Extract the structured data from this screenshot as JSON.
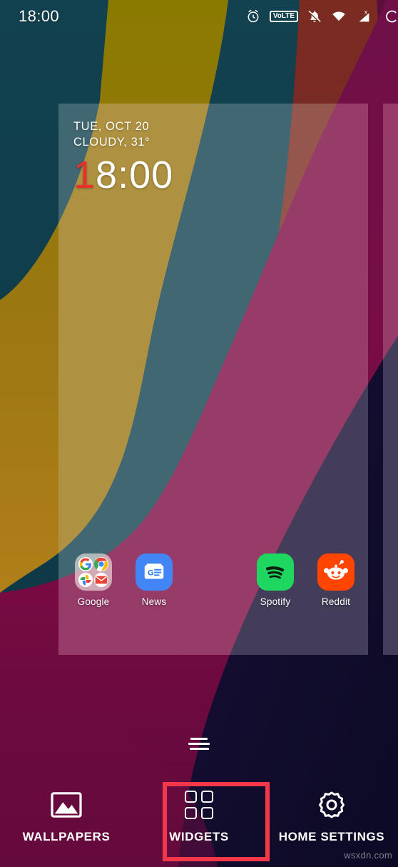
{
  "status_bar": {
    "clock": "18:00",
    "icons": [
      {
        "name": "alarm-icon",
        "label": "alarm"
      },
      {
        "name": "volte-icon",
        "label": "VoLTE"
      },
      {
        "name": "notifications-muted-icon",
        "label": "notifications muted"
      },
      {
        "name": "wifi-icon",
        "label": "wifi"
      },
      {
        "name": "cellular-signal-icon",
        "label": "no sim"
      },
      {
        "name": "battery-icon",
        "label": "battery"
      }
    ],
    "volte_text": "VoLTE"
  },
  "clock_widget": {
    "date": "TUE, OCT 20",
    "weather": "CLOUDY, 31°",
    "time_highlight": "1",
    "time_rest": "8:00",
    "highlight_color": "#e8302c"
  },
  "apps": [
    {
      "name": "google-folder",
      "label": "Google",
      "type": "folder",
      "items": [
        "google-g-icon",
        "chrome-icon",
        "photos-icon",
        "gmail-icon"
      ]
    },
    {
      "name": "news-app",
      "label": "News",
      "type": "app",
      "icon": "google-news-icon"
    },
    {
      "name": "spotify-app",
      "label": "Spotify",
      "type": "app",
      "icon": "spotify-icon"
    },
    {
      "name": "reddit-app",
      "label": "Reddit",
      "type": "app",
      "icon": "reddit-icon"
    }
  ],
  "toolbar": {
    "items": [
      {
        "name": "wallpapers-button",
        "label": "WALLPAPERS",
        "icon": "image-icon",
        "selected": false
      },
      {
        "name": "widgets-button",
        "label": "WIDGETS",
        "icon": "widgets-grid-icon",
        "selected": true
      },
      {
        "name": "home-settings-button",
        "label": "HOME SETTINGS",
        "icon": "gear-icon",
        "selected": false
      }
    ],
    "highlight_color": "#f4384a"
  },
  "page_indicator": {
    "name": "page-indicator",
    "lines": 3
  },
  "watermark": "wsxdn.com",
  "wallpaper": {
    "colors": [
      "#0d3a47",
      "#8a6a00",
      "#7a2f20",
      "#b8841a",
      "#7a0b45",
      "#120b35",
      "#5c1240"
    ]
  }
}
